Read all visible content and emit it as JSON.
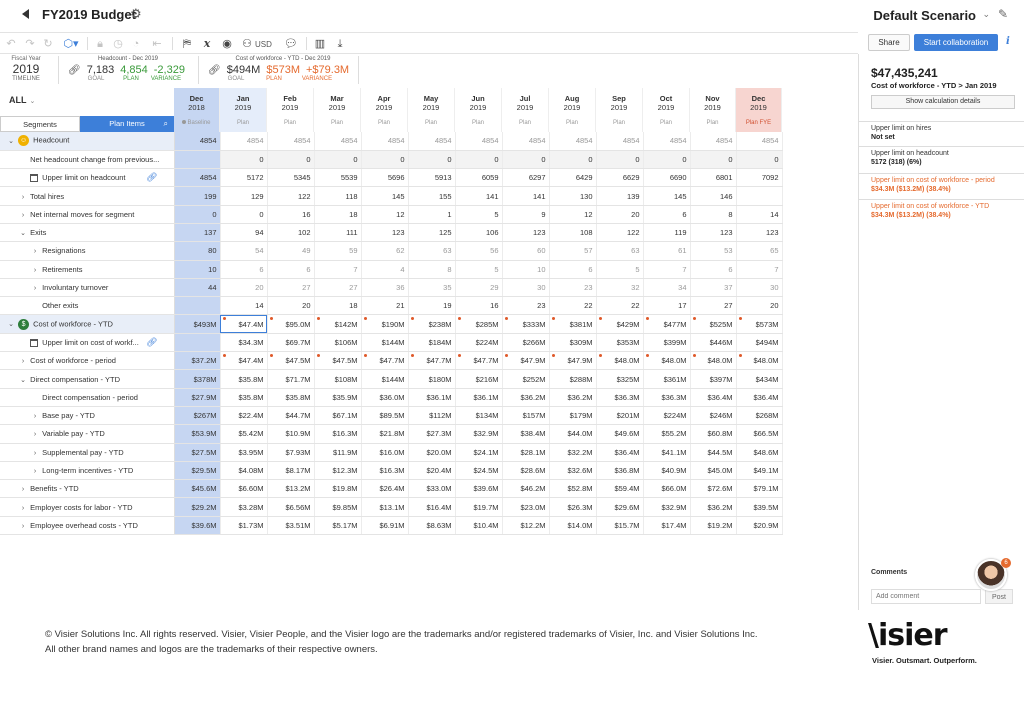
{
  "title": "FY2019 Budget",
  "scenario": "Default Scenario",
  "toolbar": {
    "currency": "USD"
  },
  "actions": {
    "share": "Share",
    "collaborate": "Start collaboration",
    "info": "i"
  },
  "kpi": {
    "fiscal_year_caption": "Fiscal Year",
    "fiscal_year": "2019",
    "timeline": "TIMELINE",
    "headcount": {
      "caption": "Headcount - Dec 2019",
      "goal": "7,183",
      "plan": "4,854",
      "variance": "-2,329",
      "goal_lbl": "GOAL",
      "plan_lbl": "PLAN",
      "var_lbl": "VARIANCE"
    },
    "cost": {
      "caption": "Cost of workforce - YTD - Dec 2019",
      "goal": "$494M",
      "plan": "$573M",
      "variance": "+$79.3M",
      "goal_lbl": "GOAL",
      "plan_lbl": "PLAN",
      "var_lbl": "VARIANCE"
    }
  },
  "grid": {
    "filter": "ALL",
    "tabs": {
      "segments": "Segments",
      "plan_items": "Plan Items"
    },
    "columns": [
      {
        "month": "Dec",
        "year": "2018",
        "sub": "Baseline"
      },
      {
        "month": "Jan",
        "year": "2019",
        "sub": "Plan"
      },
      {
        "month": "Feb",
        "year": "2019",
        "sub": "Plan"
      },
      {
        "month": "Mar",
        "year": "2019",
        "sub": "Plan"
      },
      {
        "month": "Apr",
        "year": "2019",
        "sub": "Plan"
      },
      {
        "month": "May",
        "year": "2019",
        "sub": "Plan"
      },
      {
        "month": "Jun",
        "year": "2019",
        "sub": "Plan"
      },
      {
        "month": "Jul",
        "year": "2019",
        "sub": "Plan"
      },
      {
        "month": "Aug",
        "year": "2019",
        "sub": "Plan"
      },
      {
        "month": "Sep",
        "year": "2019",
        "sub": "Plan"
      },
      {
        "month": "Oct",
        "year": "2019",
        "sub": "Plan"
      },
      {
        "month": "Nov",
        "year": "2019",
        "sub": "Plan"
      },
      {
        "month": "Dec",
        "year": "2019",
        "sub": "Plan FYE"
      }
    ],
    "rows": [
      {
        "label": "Headcount",
        "indent": 0,
        "chev": "⌄",
        "badge": "y",
        "hi": true,
        "values": [
          "4854",
          "4854",
          "4854",
          "4854",
          "4854",
          "4854",
          "4854",
          "4854",
          "4854",
          "4854",
          "4854",
          "4854",
          "4854"
        ],
        "muted": true
      },
      {
        "label": "Net headcount change from previous...",
        "indent": 1,
        "values": [
          "",
          "0",
          "0",
          "0",
          "0",
          "0",
          "0",
          "0",
          "0",
          "0",
          "0",
          "0",
          "0"
        ],
        "bg": true
      },
      {
        "label": "Upper limit on headcount",
        "indent": 1,
        "goal": true,
        "link": true,
        "values": [
          "4854",
          "5172",
          "5345",
          "5539",
          "5696",
          "5913",
          "6059",
          "6297",
          "6429",
          "6629",
          "6690",
          "6801",
          "7092",
          "7183"
        ]
      },
      {
        "label": "Total hires",
        "indent": 1,
        "chev": "›",
        "values": [
          "199",
          "129",
          "122",
          "118",
          "145",
          "155",
          "141",
          "141",
          "130",
          "139",
          "145",
          "146"
        ]
      },
      {
        "label": "Net internal moves for segment",
        "indent": 1,
        "chev": "›",
        "values": [
          "0",
          "0",
          "16",
          "18",
          "12",
          "1",
          "5",
          "9",
          "12",
          "20",
          "6",
          "8",
          "14"
        ]
      },
      {
        "label": "Exits",
        "indent": 1,
        "chev": "⌄",
        "values": [
          "137",
          "94",
          "102",
          "111",
          "123",
          "125",
          "106",
          "123",
          "108",
          "122",
          "119",
          "123",
          "123"
        ]
      },
      {
        "label": "Resignations",
        "indent": 2,
        "chev": "›",
        "muted": true,
        "values": [
          "80",
          "54",
          "49",
          "59",
          "62",
          "63",
          "56",
          "60",
          "57",
          "63",
          "61",
          "53",
          "65"
        ]
      },
      {
        "label": "Retirements",
        "indent": 2,
        "chev": "›",
        "muted": true,
        "values": [
          "10",
          "6",
          "6",
          "7",
          "4",
          "8",
          "5",
          "10",
          "6",
          "5",
          "7",
          "6",
          "7"
        ]
      },
      {
        "label": "Involuntary turnover",
        "indent": 2,
        "chev": "›",
        "muted": true,
        "values": [
          "44",
          "20",
          "27",
          "27",
          "36",
          "35",
          "29",
          "30",
          "23",
          "32",
          "34",
          "37",
          "30"
        ]
      },
      {
        "label": "Other exits",
        "indent": 2,
        "values": [
          "",
          "14",
          "20",
          "18",
          "21",
          "19",
          "16",
          "23",
          "22",
          "22",
          "17",
          "27",
          "20"
        ]
      },
      {
        "label": "Cost of workforce - YTD",
        "indent": 0,
        "chev": "⌄",
        "badge": "g",
        "hi": true,
        "dots": true,
        "sel": 1,
        "values": [
          "$493M",
          "$47.4M",
          "$95.0M",
          "$142M",
          "$190M",
          "$238M",
          "$285M",
          "$333M",
          "$381M",
          "$429M",
          "$477M",
          "$525M",
          "$573M"
        ]
      },
      {
        "label": "Upper limit on cost of workf...",
        "indent": 1,
        "goal": true,
        "link": true,
        "values": [
          "",
          "$34.3M",
          "$69.7M",
          "$106M",
          "$144M",
          "$184M",
          "$224M",
          "$266M",
          "$309M",
          "$353M",
          "$399M",
          "$446M",
          "$494M"
        ]
      },
      {
        "label": "Cost of workforce - period",
        "indent": 1,
        "chev": "›",
        "dots": true,
        "values": [
          "$37.2M",
          "$47.4M",
          "$47.5M",
          "$47.5M",
          "$47.7M",
          "$47.7M",
          "$47.7M",
          "$47.9M",
          "$47.9M",
          "$48.0M",
          "$48.0M",
          "$48.0M",
          "$48.0M"
        ]
      },
      {
        "label": "Direct compensation - YTD",
        "indent": 1,
        "chev": "⌄",
        "values": [
          "$378M",
          "$35.8M",
          "$71.7M",
          "$108M",
          "$144M",
          "$180M",
          "$216M",
          "$252M",
          "$288M",
          "$325M",
          "$361M",
          "$397M",
          "$434M"
        ]
      },
      {
        "label": "Direct compensation - period",
        "indent": 2,
        "values": [
          "$27.9M",
          "$35.8M",
          "$35.8M",
          "$35.9M",
          "$36.0M",
          "$36.1M",
          "$36.1M",
          "$36.2M",
          "$36.2M",
          "$36.3M",
          "$36.3M",
          "$36.4M",
          "$36.4M"
        ]
      },
      {
        "label": "Base pay - YTD",
        "indent": 2,
        "chev": "›",
        "values": [
          "$267M",
          "$22.4M",
          "$44.7M",
          "$67.1M",
          "$89.5M",
          "$112M",
          "$134M",
          "$157M",
          "$179M",
          "$201M",
          "$224M",
          "$246M",
          "$268M"
        ]
      },
      {
        "label": "Variable pay - YTD",
        "indent": 2,
        "chev": "›",
        "values": [
          "$53.9M",
          "$5.42M",
          "$10.9M",
          "$16.3M",
          "$21.8M",
          "$27.3M",
          "$32.9M",
          "$38.4M",
          "$44.0M",
          "$49.6M",
          "$55.2M",
          "$60.8M",
          "$66.5M"
        ]
      },
      {
        "label": "Supplemental pay - YTD",
        "indent": 2,
        "chev": "›",
        "values": [
          "$27.5M",
          "$3.95M",
          "$7.93M",
          "$11.9M",
          "$16.0M",
          "$20.0M",
          "$24.1M",
          "$28.1M",
          "$32.2M",
          "$36.4M",
          "$41.1M",
          "$44.5M",
          "$48.6M"
        ]
      },
      {
        "label": "Long-term incentives - YTD",
        "indent": 2,
        "chev": "›",
        "values": [
          "$29.5M",
          "$4.08M",
          "$8.17M",
          "$12.3M",
          "$16.3M",
          "$20.4M",
          "$24.5M",
          "$28.6M",
          "$32.6M",
          "$36.8M",
          "$40.9M",
          "$45.0M",
          "$49.1M"
        ]
      },
      {
        "label": "Benefits - YTD",
        "indent": 1,
        "chev": "›",
        "values": [
          "$45.6M",
          "$6.60M",
          "$13.2M",
          "$19.8M",
          "$26.4M",
          "$33.0M",
          "$39.6M",
          "$46.2M",
          "$52.8M",
          "$59.4M",
          "$66.0M",
          "$72.6M",
          "$79.1M"
        ]
      },
      {
        "label": "Employer costs for labor - YTD",
        "indent": 1,
        "chev": "›",
        "values": [
          "$29.2M",
          "$3.28M",
          "$6.56M",
          "$9.85M",
          "$13.1M",
          "$16.4M",
          "$19.7M",
          "$23.0M",
          "$26.3M",
          "$29.6M",
          "$32.9M",
          "$36.2M",
          "$39.5M"
        ]
      },
      {
        "label": "Employee overhead costs - YTD",
        "indent": 1,
        "chev": "›",
        "values": [
          "$39.6M",
          "$1.73M",
          "$3.51M",
          "$5.17M",
          "$6.91M",
          "$8.63M",
          "$10.4M",
          "$12.2M",
          "$14.0M",
          "$15.7M",
          "$17.4M",
          "$19.2M",
          "$20.9M"
        ]
      }
    ]
  },
  "panel": {
    "total": "$47,435,241",
    "subtitle": "Cost of workforce - YTD > Jan 2019",
    "calc_btn": "Show calculation details",
    "items": [
      {
        "title": "Upper limit on hires",
        "value": "Not set",
        "alert": false
      },
      {
        "title": "Upper limit on headcount",
        "value": "5172   (318)   (6%)",
        "alert": false
      },
      {
        "title": "Upper limit on cost of workforce - period",
        "value": "$34.3M   ($13.2M)   (38.4%)",
        "alert": true
      },
      {
        "title": "Upper limit on cost of workforce - YTD",
        "value": "$34.3M   ($13.2M)   (38.4%)",
        "alert": true
      }
    ],
    "comments_label": "Comments",
    "comment_placeholder": "Add comment",
    "post": "Post",
    "avatar_badge": "6"
  },
  "footer": {
    "line1": "© Visier Solutions Inc. All rights reserved. Visier, Visier People, and the Visier logo are the trademarks and/or registered trademarks of Visier, Inc. and Visier Solutions Inc.",
    "line2": "All other brand names and logos are the trademarks of their respective owners.",
    "logo": "\\isier",
    "tagline": "Visier. Outsmart. Outperform."
  }
}
